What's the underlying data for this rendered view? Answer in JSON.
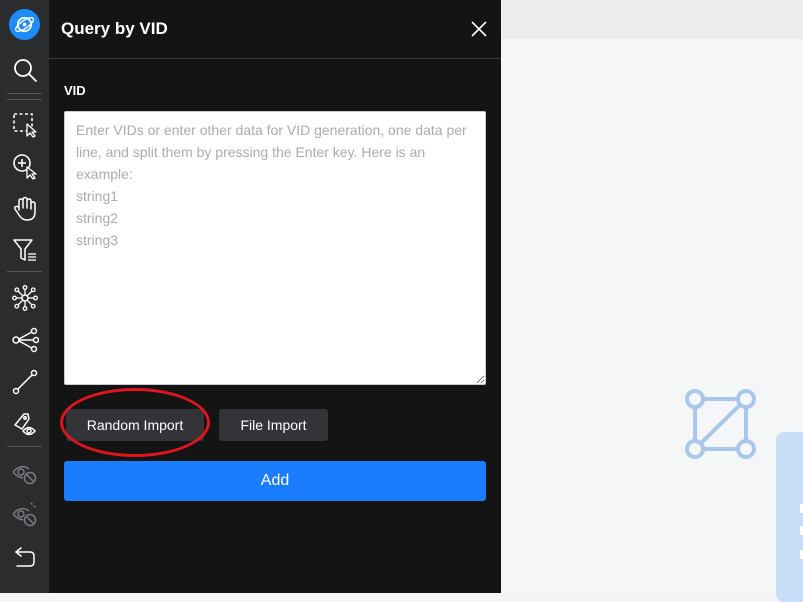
{
  "toolbar": {
    "items": [
      {
        "icon": "search-icon"
      },
      {
        "icon": "box-select-icon"
      },
      {
        "icon": "add-select-icon"
      },
      {
        "icon": "hand-icon"
      },
      {
        "icon": "filter-icon"
      },
      {
        "icon": "network-expand-icon"
      },
      {
        "icon": "share-nodes-icon"
      },
      {
        "icon": "path-icon"
      },
      {
        "icon": "tag-visibility-icon"
      },
      {
        "icon": "hide-node-icon"
      },
      {
        "icon": "hide-edge-icon"
      },
      {
        "icon": "undo-icon"
      }
    ]
  },
  "panel": {
    "title": "Query by VID",
    "vid_label": "VID",
    "vid_input": {
      "value": "",
      "placeholder": "Enter VIDs or enter other data for VID generation, one data per line, and split them by pressing the Enter key. Here is an example:\nstring1\nstring2\nstring3"
    },
    "random_import_label": "Random Import",
    "file_import_label": "File Import",
    "add_label": "Add"
  },
  "colors": {
    "rail_bg": "#2b2c2e",
    "panel_bg": "#141414",
    "accent": "#1a7cff",
    "highlight": "#e0141e",
    "canvas_bg": "#f5f6f8"
  }
}
